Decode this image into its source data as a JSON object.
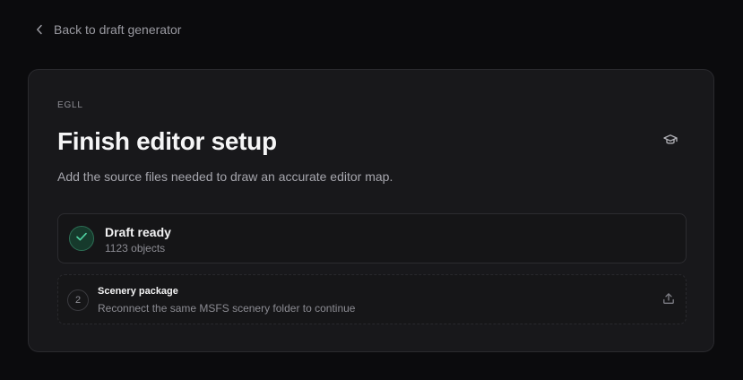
{
  "nav": {
    "back_label": "Back to draft generator"
  },
  "card": {
    "eyebrow": "EGLL",
    "title": "Finish editor setup",
    "subtitle": "Add the source files needed to draw an accurate editor map.",
    "help_icon": "graduation-cap-icon"
  },
  "steps": [
    {
      "status": "done",
      "icon": "check-icon",
      "title": "Draft ready",
      "detail": "1123 objects"
    },
    {
      "status": "pending",
      "number": "2",
      "title": "Scenery package",
      "detail": "Reconnect the same MSFS scenery folder to continue",
      "action_icon": "upload-icon"
    }
  ],
  "colors": {
    "background": "#0b0b0d",
    "card": "#18181b",
    "success": "#4fd1a1",
    "muted_text": "#9a9aa1"
  }
}
